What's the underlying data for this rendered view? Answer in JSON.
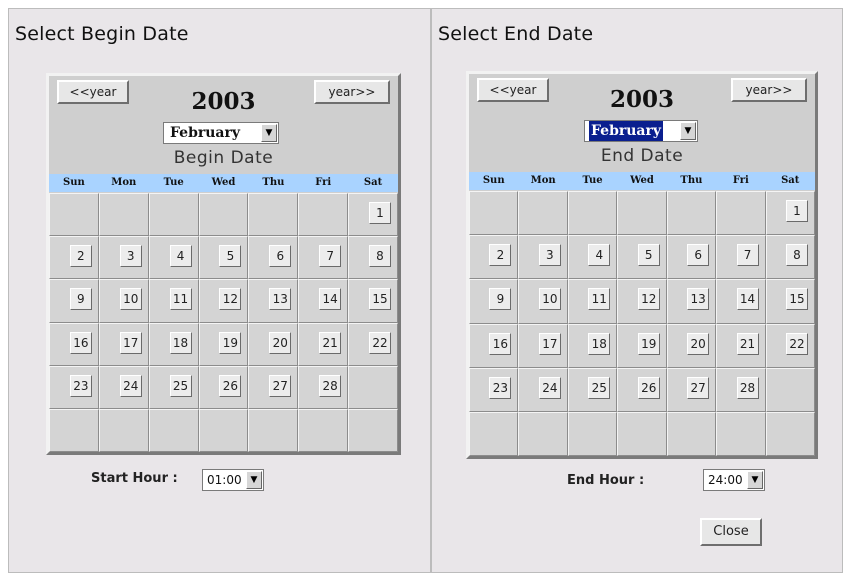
{
  "begin": {
    "title": "Select Begin Date",
    "prev_year": "<<year",
    "next_year": "year>>",
    "year": "2003",
    "month": "February",
    "label": "Begin Date",
    "hour_label": "Start Hour :",
    "hour_value": "01:00"
  },
  "end": {
    "title": "Select End Date",
    "prev_year": "<<year",
    "next_year": "year>>",
    "year": "2003",
    "month": "February",
    "label": "End Date",
    "hour_label": "End Hour :",
    "hour_value": "24:00"
  },
  "weekdays": [
    "Sun",
    "Mon",
    "Tue",
    "Wed",
    "Thu",
    "Fri",
    "Sat"
  ],
  "days": [
    [
      "",
      "",
      "",
      "",
      "",
      "",
      "1"
    ],
    [
      "2",
      "3",
      "4",
      "5",
      "6",
      "7",
      "8"
    ],
    [
      "9",
      "10",
      "11",
      "12",
      "13",
      "14",
      "15"
    ],
    [
      "16",
      "17",
      "18",
      "19",
      "20",
      "21",
      "22"
    ],
    [
      "23",
      "24",
      "25",
      "26",
      "27",
      "28",
      ""
    ],
    [
      "",
      "",
      "",
      "",
      "",
      "",
      ""
    ]
  ],
  "close_label": "Close",
  "icons": {
    "dropdown": "chevron-down-icon"
  },
  "colors": {
    "weekday_bar": "#a9d3ff",
    "month_highlight": "#0a1f8f",
    "panel_bg": "#e9e6e9"
  }
}
